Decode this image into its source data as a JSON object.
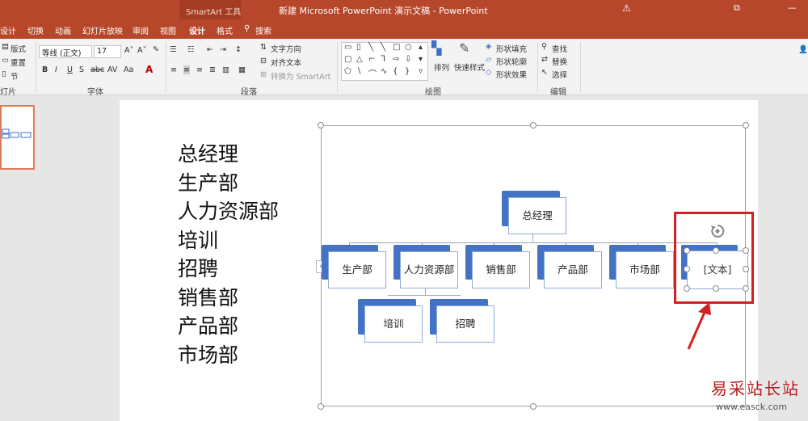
{
  "window": {
    "contextual_label": "SmartArt 工具",
    "title": "新建 Microsoft PowerPoint 演示文稿 - PowerPoint"
  },
  "tabs": [
    "设计",
    "切换",
    "动画",
    "幻灯片放映",
    "审阅",
    "视图",
    "设计",
    "格式",
    "搜索"
  ],
  "ribbon": {
    "slides_group": {
      "layout": "版式",
      "reset": "重置",
      "section": "节",
      "label": "灯片"
    },
    "font_group": {
      "font_name": "等线 (正文)",
      "font_size": "17",
      "label": "字体"
    },
    "paragraph_group": {
      "text_direction": "文字方向",
      "align_text": "对齐文本",
      "convert_smartart": "转换为 SmartArt",
      "label": "段落"
    },
    "drawing_group": {
      "arrange": "排列",
      "quick_styles": "快速样式",
      "shape_fill": "形状填充",
      "shape_outline": "形状轮廓",
      "shape_effects": "形状效果",
      "label": "绘图"
    },
    "editing_group": {
      "find": "查找",
      "replace": "替换",
      "select": "选择",
      "label": "编辑"
    }
  },
  "slide": {
    "list_items": [
      "总经理",
      "生产部",
      "人力资源部",
      "培训",
      "招聘",
      "销售部",
      "产品部",
      "市场部"
    ],
    "org_chart": {
      "top": "总经理",
      "level2": [
        "生产部",
        "人力资源部",
        "销售部",
        "产品部",
        "市场部",
        "[文本]"
      ],
      "level3": [
        "培训",
        "招聘"
      ]
    }
  },
  "watermark": {
    "text": "易采站长站",
    "url": "www.easck.com"
  },
  "colors": {
    "accent": "#b7472a",
    "node_fill": "#4472c4",
    "highlight": "#d42020"
  }
}
